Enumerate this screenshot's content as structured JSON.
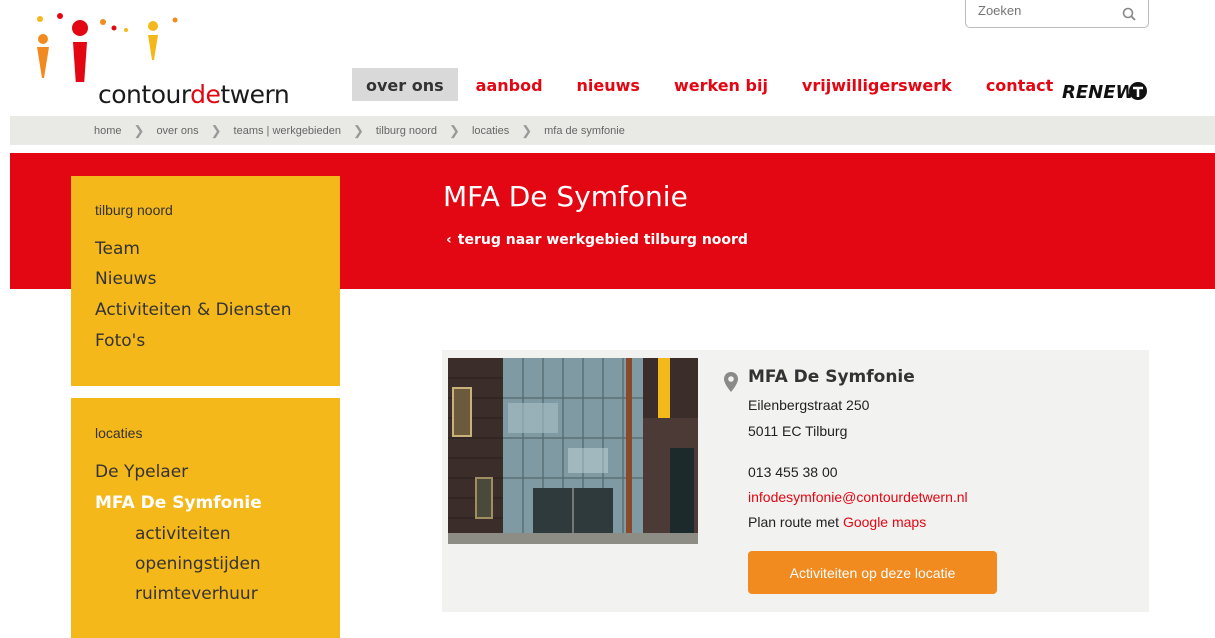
{
  "header": {
    "logo": {
      "prefix": "contour",
      "accent": "de",
      "suffix": "twern"
    },
    "search": {
      "placeholder": "Zoeken"
    },
    "nav": [
      {
        "label": "over ons",
        "active": true
      },
      {
        "label": "aanbod"
      },
      {
        "label": "nieuws"
      },
      {
        "label": "werken bij"
      },
      {
        "label": "vrijwilligerswerk"
      },
      {
        "label": "contact"
      }
    ],
    "partner_logo": "RENEW"
  },
  "breadcrumb": [
    "home",
    "over ons",
    "teams | werkgebieden",
    "tilburg noord",
    "locaties",
    "mfa de symfonie"
  ],
  "banner": {
    "title": "MFA De Symfonie",
    "back_link": "terug naar werkgebied tilburg noord"
  },
  "sidebar": {
    "area": {
      "heading": "tilburg noord",
      "links": [
        "Team",
        "Nieuws",
        "Activiteiten & Diensten",
        "Foto's"
      ]
    },
    "locations": {
      "heading": "locaties",
      "links": [
        {
          "label": "De Ypelaer"
        },
        {
          "label": "MFA De Symfonie",
          "current": true
        }
      ],
      "sublinks": [
        "activiteiten",
        "openingstijden",
        "ruimteverhuur"
      ]
    }
  },
  "location": {
    "name": "MFA De Symfonie",
    "street": "Eilenbergstraat 250",
    "postal_city": "5011 EC Tilburg",
    "phone": "013 455 38 00",
    "email": "infodesymfonie@contourdetwern.nl",
    "route_prefix": "Plan route met",
    "route_link": "Google maps",
    "button": "Activiteiten op deze locatie"
  },
  "colors": {
    "brand_red": "#e30613",
    "sidebar_yellow": "#f4b81a",
    "cta_orange": "#f18a1f",
    "breadcrumb_bg": "#e9eae6"
  }
}
